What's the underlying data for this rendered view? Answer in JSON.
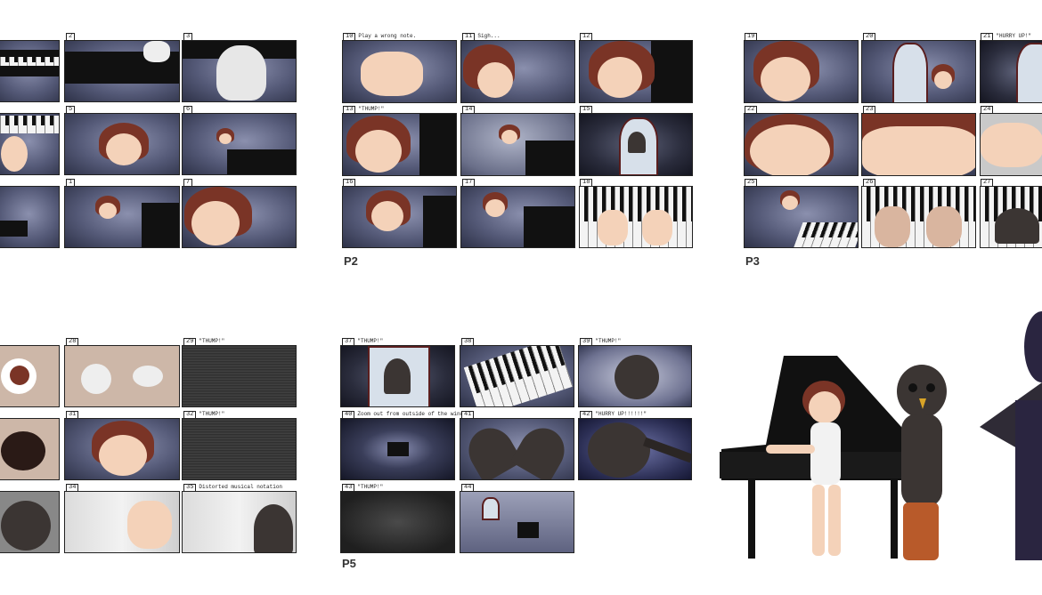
{
  "page_labels": {
    "p2": "P2",
    "p3": "P3",
    "p5": "P5"
  },
  "panels": {
    "p1_2": "2",
    "p1_3": "3",
    "p1_5": "5",
    "p1_6": "6",
    "p1_1": "1",
    "p1_7": "7",
    "p2_10": "10",
    "p2_10_cap": "Play a wrong note.",
    "p2_11": "11",
    "p2_11_cap": "Sigh...",
    "p2_12": "12",
    "p2_13": "13",
    "p2_13_cap": "\"THUMP!\"",
    "p2_14": "14",
    "p2_15": "15",
    "p2_16": "16",
    "p2_17": "17",
    "p2_18": "18",
    "p3_19": "19",
    "p3_20": "20",
    "p3_21": "21",
    "p3_21_cap": "\"HURRY UP!\"",
    "p3_22": "22",
    "p3_23": "23",
    "p3_24": "24",
    "p3_25": "25",
    "p3_26": "26",
    "p3_27": "27",
    "p4_28": "28",
    "p4_29": "29",
    "p4_29_cap": "\"THUMP!\"",
    "p4_31": "31",
    "p4_32": "32",
    "p4_32_cap": "\"THUMP!\"",
    "p4_34": "34",
    "p4_35": "35",
    "p4_35_cap": "Distorted musical notation",
    "p5_37": "37",
    "p5_37_cap": "\"THUMP!\"",
    "p5_38": "38",
    "p5_39": "39",
    "p5_39_cap": "\"THUMP!\"",
    "p5_40": "40",
    "p5_40_cap": "Zoom out from outside of the window",
    "p5_41": "41",
    "p5_42": "42",
    "p5_42_cap": "\"HURRY UP!!!!!!\"",
    "p5_43": "43",
    "p5_43_cap": "\"THUMP!\"",
    "p5_44": "44"
  },
  "colors": {
    "title_purple": "#5b2b7a",
    "panel_blue": "#555a78",
    "hair": "#7a3426"
  }
}
